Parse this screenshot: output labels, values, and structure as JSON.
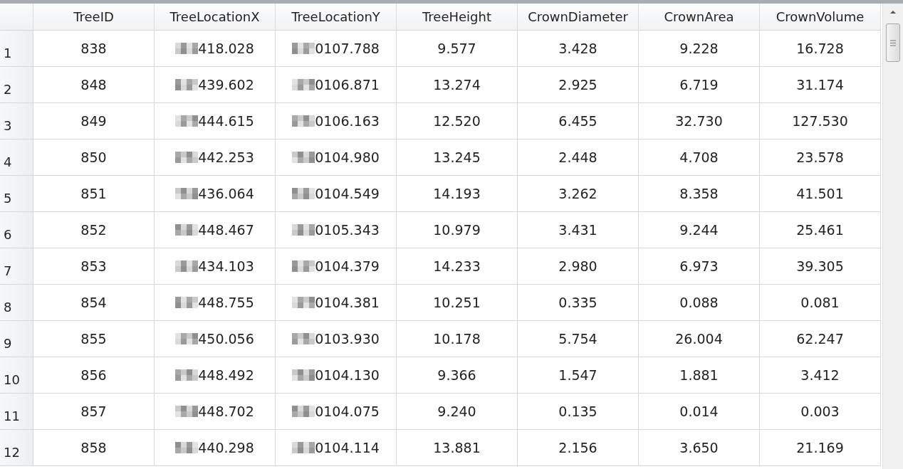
{
  "table": {
    "columns": [
      "TreeID",
      "TreeLocationX",
      "TreeLocationY",
      "TreeHeight",
      "CrownDiameter",
      "CrownArea",
      "CrownVolume"
    ],
    "rows": [
      {
        "number": "1",
        "cells": [
          "838",
          "418.028",
          "0107.788",
          "9.577",
          "3.428",
          "9.228",
          "16.728"
        ]
      },
      {
        "number": "2",
        "cells": [
          "848",
          "439.602",
          "0106.871",
          "13.274",
          "2.925",
          "6.719",
          "31.174"
        ]
      },
      {
        "number": "3",
        "cells": [
          "849",
          "444.615",
          "0106.163",
          "12.520",
          "6.455",
          "32.730",
          "127.530"
        ]
      },
      {
        "number": "4",
        "cells": [
          "850",
          "442.253",
          "0104.980",
          "13.245",
          "2.448",
          "4.708",
          "23.578"
        ]
      },
      {
        "number": "5",
        "cells": [
          "851",
          "436.064",
          "0104.549",
          "14.193",
          "3.262",
          "8.358",
          "41.501"
        ]
      },
      {
        "number": "6",
        "cells": [
          "852",
          "448.467",
          "0105.343",
          "10.979",
          "3.431",
          "9.244",
          "25.461"
        ]
      },
      {
        "number": "7",
        "cells": [
          "853",
          "434.103",
          "0104.379",
          "14.233",
          "2.980",
          "6.973",
          "39.305"
        ]
      },
      {
        "number": "8",
        "cells": [
          "854",
          "448.755",
          "0104.381",
          "10.251",
          "0.335",
          "0.088",
          "0.081"
        ]
      },
      {
        "number": "9",
        "cells": [
          "855",
          "450.056",
          "0103.930",
          "10.178",
          "5.754",
          "26.004",
          "62.247"
        ]
      },
      {
        "number": "10",
        "cells": [
          "856",
          "448.492",
          "0104.130",
          "9.366",
          "1.547",
          "1.881",
          "3.412"
        ]
      },
      {
        "number": "11",
        "cells": [
          "857",
          "448.702",
          "0104.075",
          "9.240",
          "0.135",
          "0.014",
          "0.003"
        ]
      },
      {
        "number": "12",
        "cells": [
          "858",
          "440.298",
          "0104.114",
          "13.881",
          "2.156",
          "3.650",
          "21.169"
        ]
      }
    ]
  }
}
